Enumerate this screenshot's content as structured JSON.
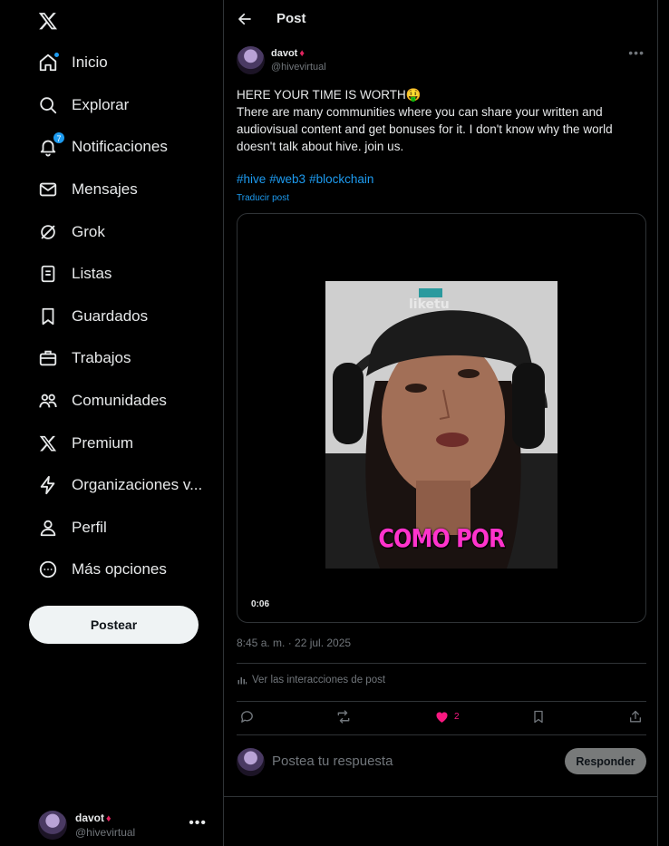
{
  "sidebar": {
    "items": [
      {
        "label": "Inicio"
      },
      {
        "label": "Explorar"
      },
      {
        "label": "Notificaciones",
        "badge": "7"
      },
      {
        "label": "Mensajes"
      },
      {
        "label": "Grok"
      },
      {
        "label": "Listas"
      },
      {
        "label": "Guardados"
      },
      {
        "label": "Trabajos"
      },
      {
        "label": "Comunidades"
      },
      {
        "label": "Premium"
      },
      {
        "label": "Organizaciones v..."
      },
      {
        "label": "Perfil"
      },
      {
        "label": "Más opciones"
      }
    ],
    "post_button": "Postear",
    "account": {
      "name": "davot",
      "handle": "@hivevirtual",
      "more": "•••"
    }
  },
  "header": {
    "title": "Post"
  },
  "post": {
    "author": {
      "name": "davot",
      "handle": "@hivevirtual"
    },
    "more": "•••",
    "line1": "HERE YOUR TIME IS WORTH🤑",
    "line2": "There are many communities where you can share your written and audiovisual content and get bonuses for it. I don't know why the world doesn't talk about hive. join us.",
    "hashtags": [
      "#hive",
      "#web3",
      "#blockchain"
    ],
    "translate": "Traducir post",
    "video": {
      "time": "0:06",
      "caption": "COMO POR",
      "cap_text": "liketu"
    },
    "timestamp": "8:45 a. m. · 22 jul. 2025",
    "interactions": "Ver las interacciones de post",
    "likes": "2"
  },
  "reply": {
    "placeholder": "Postea tu respuesta",
    "button": "Responder"
  },
  "colors": {
    "accent": "#1d9bf0",
    "like": "#f91880",
    "background": "#000000",
    "border": "#2f3336"
  }
}
